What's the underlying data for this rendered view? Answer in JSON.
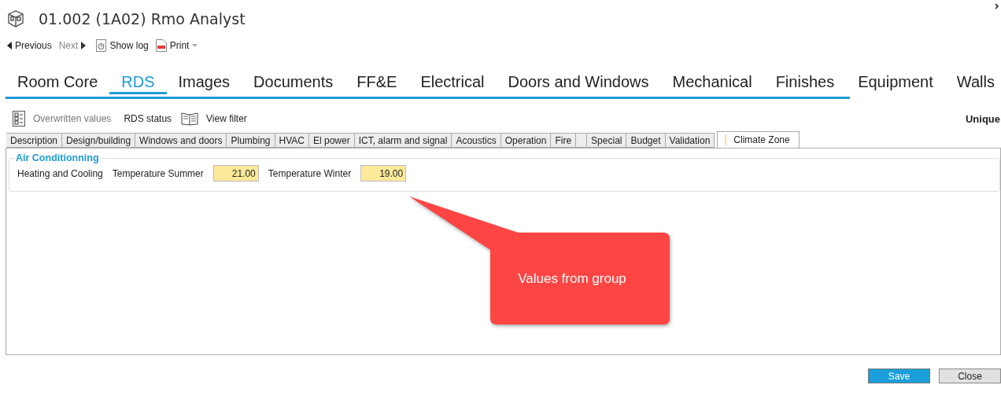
{
  "window": {
    "title": "01.002 (1A02) Rmo Analyst"
  },
  "toolbar": [
    {
      "label": "Previous",
      "kind": "prev",
      "disabled": false
    },
    {
      "label": "Next",
      "kind": "next",
      "disabled": true
    },
    {
      "label": "Show log",
      "kind": "log",
      "disabled": false
    },
    {
      "label": "Print",
      "kind": "print",
      "disabled": false
    }
  ],
  "main_tabs": [
    {
      "label": "Room Core",
      "selected": false
    },
    {
      "label": "RDS",
      "selected": true
    },
    {
      "label": "Images",
      "selected": false
    },
    {
      "label": "Documents",
      "selected": false
    },
    {
      "label": "FF&E",
      "selected": false
    },
    {
      "label": "Electrical",
      "selected": false
    },
    {
      "label": "Doors and Windows",
      "selected": false
    },
    {
      "label": "Mechanical",
      "selected": false
    },
    {
      "label": "Finishes",
      "selected": false
    },
    {
      "label": "Equipment",
      "selected": false
    },
    {
      "label": "Walls",
      "selected": false
    }
  ],
  "rds_toolbar": {
    "overwritten": {
      "label": "Overwritten values",
      "disabled": true
    },
    "status": "RDS status",
    "filter": "View filter",
    "right_label": "Unique"
  },
  "sub_tabs": [
    {
      "kind": "text",
      "label": "Description",
      "selected": false
    },
    {
      "kind": "text",
      "label": "Design/building",
      "selected": false
    },
    {
      "kind": "text",
      "label": "Windows and doors",
      "selected": false
    },
    {
      "kind": "text",
      "label": "Plumbing",
      "selected": false
    },
    {
      "kind": "text",
      "label": "HVAC",
      "selected": false
    },
    {
      "kind": "text",
      "label": "El power",
      "selected": false
    },
    {
      "kind": "text",
      "label": "ICT, alarm and signal",
      "selected": false
    },
    {
      "kind": "text",
      "label": "Acoustics",
      "selected": false
    },
    {
      "kind": "text",
      "label": "Operation",
      "selected": false
    },
    {
      "kind": "text",
      "label": "Fire",
      "selected": false
    },
    {
      "kind": "blank",
      "selected": false
    },
    {
      "kind": "text",
      "label": "Special",
      "selected": false
    },
    {
      "kind": "text",
      "label": "Budget",
      "selected": false
    },
    {
      "kind": "text",
      "label": "Validation",
      "selected": false
    },
    {
      "kind": "text",
      "label": "Climate Zone",
      "selected": true
    }
  ],
  "group": {
    "title": "Air Conditionning",
    "label": "Heating and Cooling",
    "fields": [
      {
        "label": "Temperature Summer",
        "value": "21.00"
      },
      {
        "label": "Temperature Winter",
        "value": "19.00"
      }
    ]
  },
  "callout": {
    "text": "Values from group"
  },
  "buttons": [
    {
      "label": "Save",
      "kind": "primary"
    },
    {
      "label": "Close",
      "kind": "secondary"
    }
  ]
}
